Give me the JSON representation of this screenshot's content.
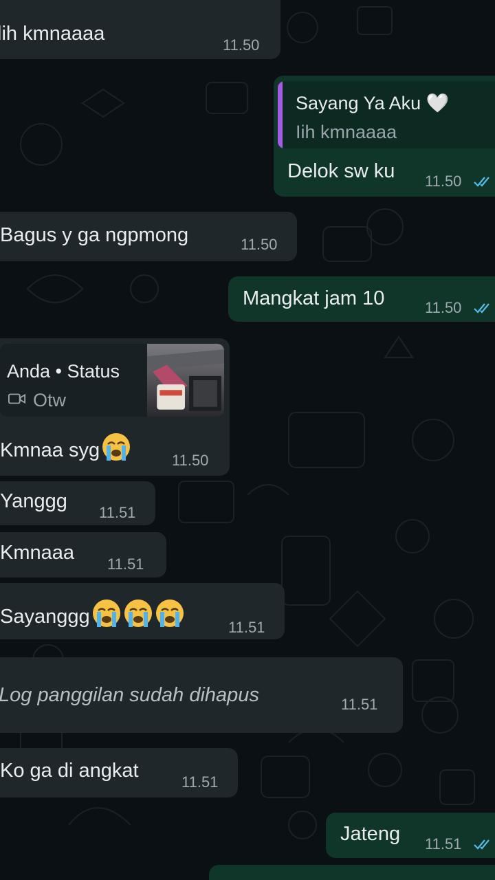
{
  "messages": [
    {
      "id": "m1",
      "text": "lih kmnaaaa",
      "time": "11.50"
    },
    {
      "id": "m2",
      "quote_author": "Sayang Ya Aku 🤍",
      "quote_text": "Iih kmnaaaa",
      "text": "Delok sw ku",
      "time": "11.50"
    },
    {
      "id": "m3",
      "text": "Bagus y ga ngpmong",
      "time": "11.50"
    },
    {
      "id": "m4",
      "text": "Mangkat jam 10",
      "time": "11.50"
    },
    {
      "id": "m5",
      "status_author": "Anda • Status",
      "status_caption": "Otw",
      "text": "Kmnaa syg",
      "time": "11.50"
    },
    {
      "id": "m6",
      "text": "Yanggg",
      "time": "11.51"
    },
    {
      "id": "m7",
      "text": "Kmnaaa",
      "time": "11.51"
    },
    {
      "id": "m8",
      "text": "Sayanggg",
      "time": "11.51"
    },
    {
      "id": "m9",
      "text": "Log panggilan sudah dihapus",
      "time": "11.51"
    },
    {
      "id": "m10",
      "text": "Ko ga di angkat",
      "time": "11.51"
    },
    {
      "id": "m11",
      "text": "Jateng",
      "time": "11.51"
    }
  ],
  "icons": {
    "read_receipt": "double-check-icon",
    "status_video": "video-camera-icon",
    "crying": "crying-face-emoji"
  },
  "colors": {
    "background": "#0b1014",
    "incoming_bubble": "#1f272a",
    "outgoing_bubble": "#103529",
    "read_tick": "#53bdeb",
    "quote_bar": "#a55be6"
  }
}
